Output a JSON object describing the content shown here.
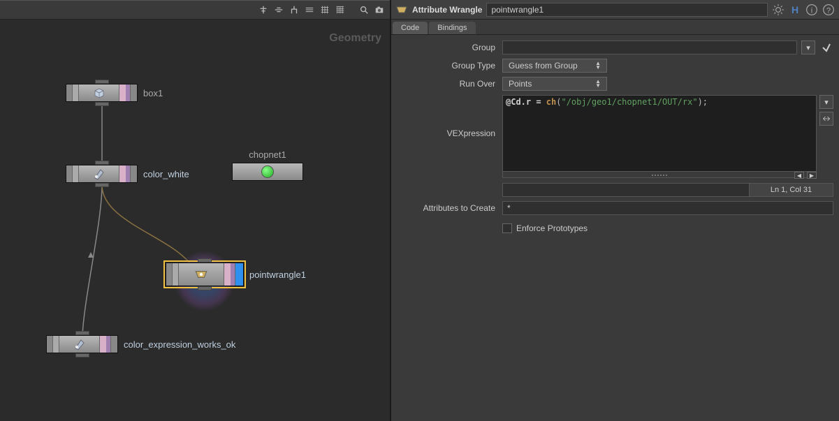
{
  "network": {
    "label": "Geometry",
    "nodes": {
      "box": {
        "label": "box1"
      },
      "color_white": {
        "label": "color_white"
      },
      "chopnet": {
        "label": "chopnet1"
      },
      "pointwrangle": {
        "label": "pointwrangle1"
      },
      "color_expr": {
        "label": "color_expression_works_ok"
      }
    }
  },
  "paramPane": {
    "title": "Attribute Wrangle",
    "nodeName": "pointwrangle1",
    "tabs": {
      "code": "Code",
      "bindings": "Bindings"
    },
    "params": {
      "group_label": "Group",
      "group_value": "",
      "group_type_label": "Group Type",
      "group_type_value": "Guess from Group",
      "run_over_label": "Run Over",
      "run_over_value": "Points",
      "vex_label": "VEXpression",
      "code_tokens": {
        "pre": "@Cd.r = ",
        "fn": "ch",
        "open": "(",
        "str": "\"/obj/geo1/chopnet1/OUT/rx\"",
        "close": ");"
      },
      "lncol": "Ln 1, Col 31",
      "attrs_create_label": "Attributes to Create",
      "attrs_create_value": "*",
      "enforce_proto_label": "Enforce Prototypes"
    }
  }
}
